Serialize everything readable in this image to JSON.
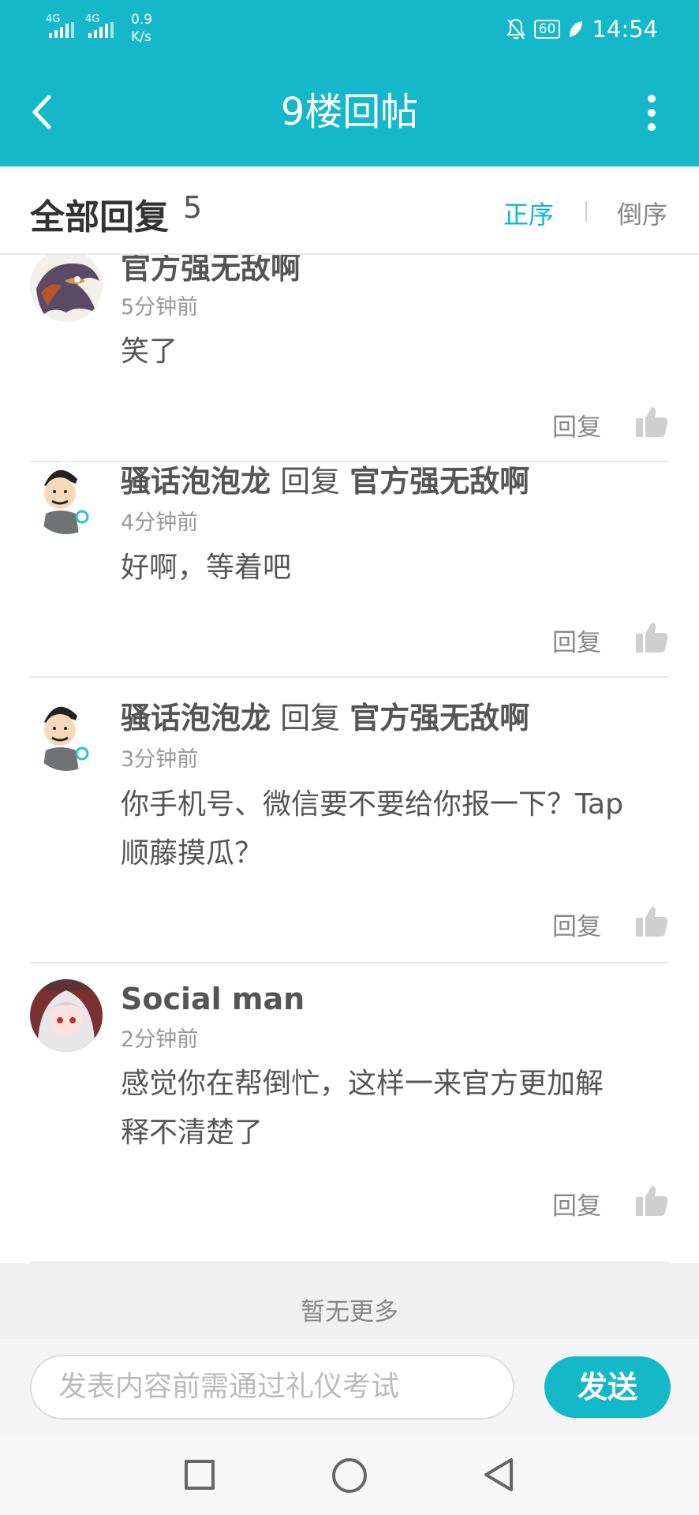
{
  "status_bar": {
    "signal1": "4G",
    "signal2": "4G",
    "net_speed_value": "0.9",
    "net_speed_unit": "K/s",
    "battery": "60",
    "time": "14:54",
    "icons": [
      "mute-bell-icon",
      "battery-icon",
      "leaf-icon"
    ]
  },
  "header": {
    "title": "9楼回帖",
    "back_icon": "back-arrow-icon",
    "more_icon": "more-vertical-icon"
  },
  "sort_bar": {
    "title": "全部回复",
    "count": "5",
    "asc_label": "正序",
    "desc_label": "倒序",
    "active": "正序"
  },
  "replies": [
    {
      "author": "官方强无敌啊",
      "reply_word": "",
      "target": "",
      "time": "5分钟前",
      "content": "笑了",
      "reply_label": "回复",
      "like_icon": "thumbs-up-icon"
    },
    {
      "author": "骚话泡泡龙",
      "reply_word": "回复",
      "target": "官方强无敌啊",
      "time": "4分钟前",
      "content": "好啊，等着吧",
      "reply_label": "回复",
      "like_icon": "thumbs-up-icon"
    },
    {
      "author": "骚话泡泡龙",
      "reply_word": "回复",
      "target": "官方强无敌啊",
      "time": "3分钟前",
      "content_line1": "你手机号、微信要不要给你报一下？Tap",
      "content_line2": "顺藤摸瓜？",
      "reply_label": "回复",
      "like_icon": "thumbs-up-icon"
    },
    {
      "author": "Social man",
      "reply_word": "",
      "target": "",
      "time": "2分钟前",
      "content_line1": "感觉你在帮倒忙，这样一来官方更加解",
      "content_line2": "释不清楚了",
      "reply_label": "回复",
      "like_icon": "thumbs-up-icon"
    }
  ],
  "footer": {
    "no_more": "暂无更多"
  },
  "composer": {
    "placeholder": "发表内容前需通过礼仪考试",
    "send_label": "发送"
  },
  "colors": {
    "accent": "#14b8c8",
    "text": "#555555",
    "muted": "#999999"
  }
}
